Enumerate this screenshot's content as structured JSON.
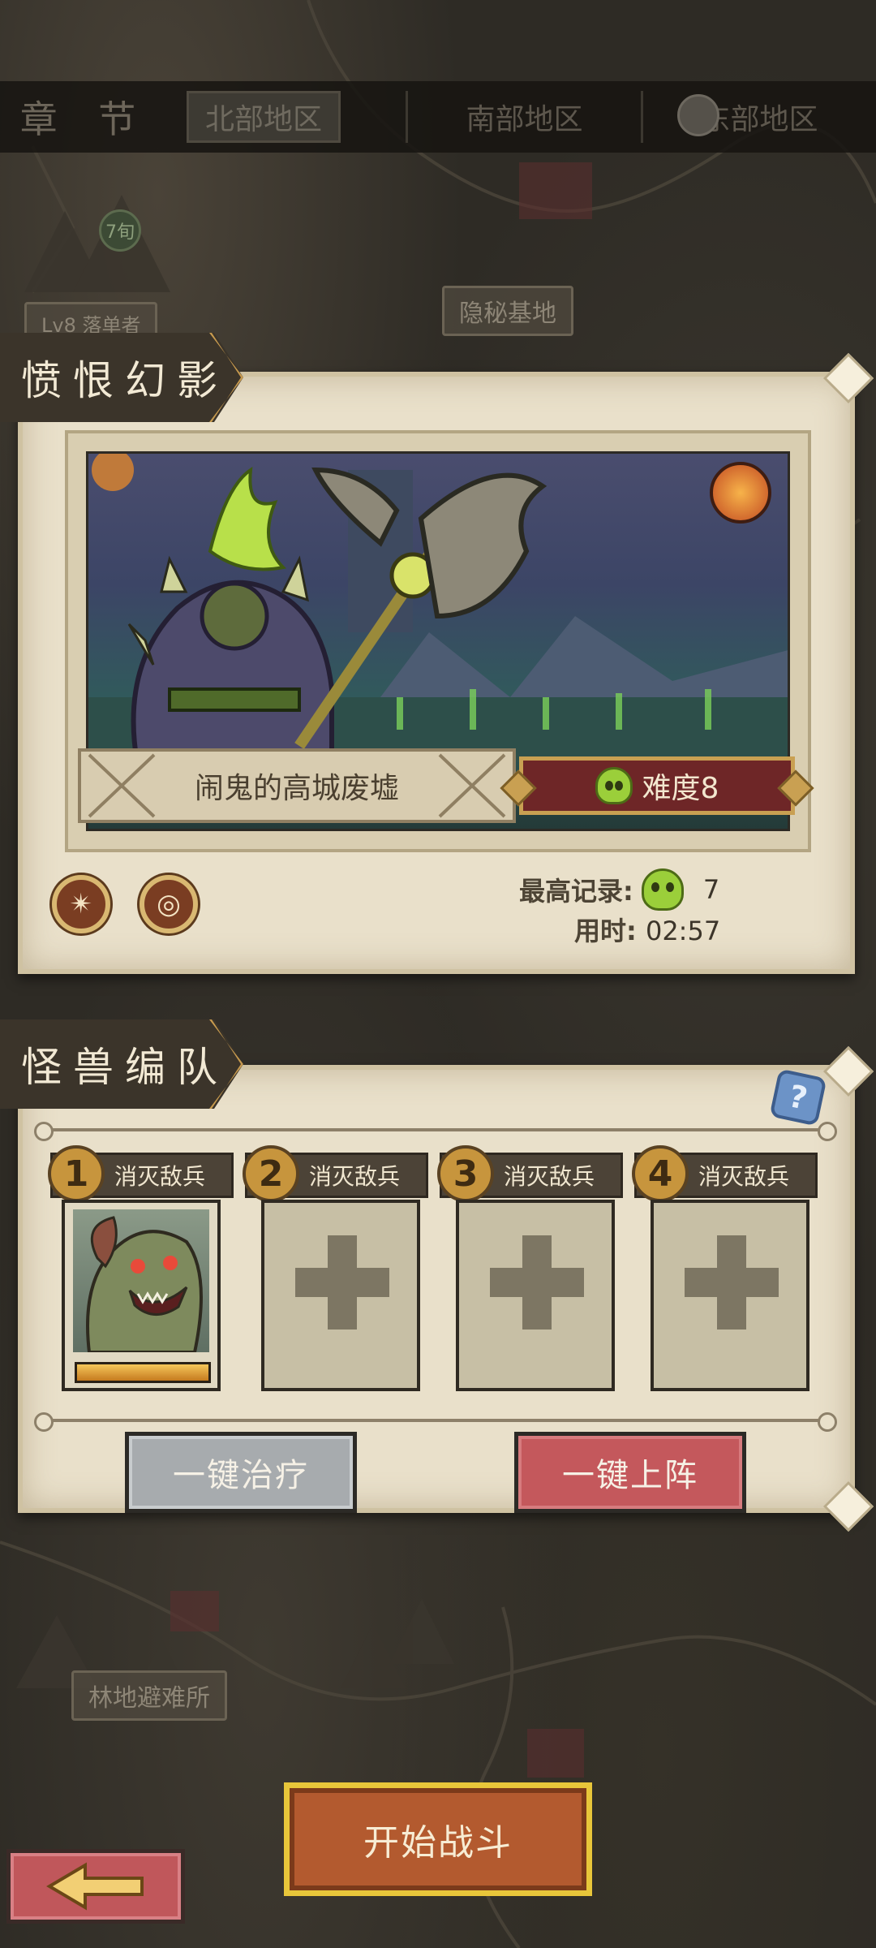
{
  "chapter_bar": {
    "label": "章 节",
    "tabs": [
      {
        "label": "北部地区",
        "selected": true
      },
      {
        "label": "南部地区",
        "selected": false
      },
      {
        "label": "东部地区",
        "selected": false,
        "locked": true
      }
    ]
  },
  "map": {
    "labels": {
      "hidden_base": "隐秘基地",
      "forest_shelter": "林地避难所",
      "outcast": "Lv8 落单者"
    },
    "badge": "7旬"
  },
  "stage_section": {
    "title": "愤恨幻影",
    "stage_name": "闹鬼的高城废墟",
    "difficulty_label": "难度8",
    "best_record_label": "最高记录:",
    "best_record_value": "7",
    "time_label": "用时:",
    "time_value": "02:57",
    "skill_icons": [
      "claw-skill-icon",
      "swirl-skill-icon"
    ]
  },
  "team_section": {
    "title": "怪兽编队",
    "slots": [
      {
        "num": "1",
        "task": "消灭敌兵",
        "filled": true,
        "hp_fraction": 1.0
      },
      {
        "num": "2",
        "task": "消灭敌兵",
        "filled": false
      },
      {
        "num": "3",
        "task": "消灭敌兵",
        "filled": false
      },
      {
        "num": "4",
        "task": "消灭敌兵",
        "filled": false
      }
    ],
    "heal_label": "一键治疗",
    "deploy_label": "一键上阵"
  },
  "footer": {
    "start_label": "开始战斗",
    "back_icon": "arrow-left-icon"
  },
  "colors": {
    "parchment": "#e9e0ca",
    "difficulty": "#6e2627",
    "gold": "#c9a052",
    "heal_button": "#a7abae",
    "deploy_button": "#c4585c",
    "start_button": "#b35a2f",
    "skull": "#9bcf3a"
  }
}
